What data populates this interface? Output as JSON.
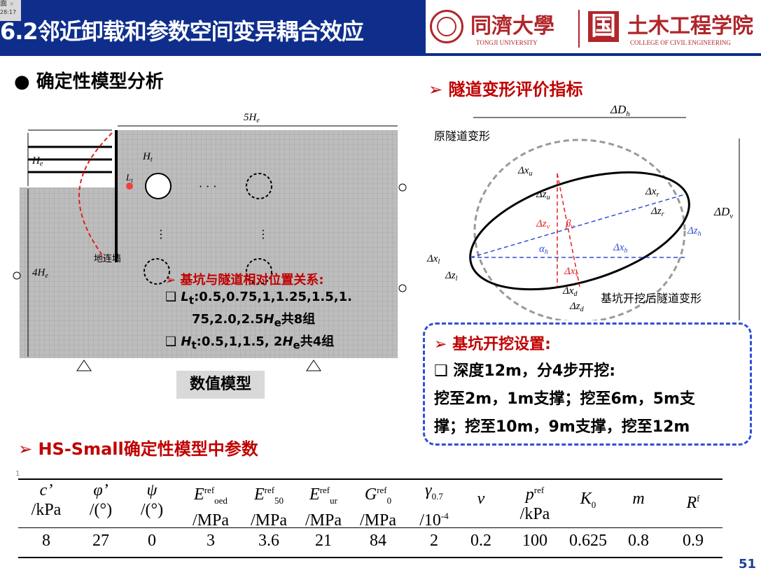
{
  "header": {
    "title": "6.2邻近卸载和参数空间变异耦合效应",
    "corner_tag_top": "面",
    "corner_tag_close": "×",
    "corner_tag_time": "28:17",
    "university_cn": "同濟大學",
    "university_en": "TONGJI UNIVERSITY",
    "college_cn": "土木工程学院",
    "college_en": "COLLEGE OF CIVIL ENGINEERING",
    "college_icon_glyph": "国",
    "accent_color": "#0f2e8c",
    "brand_red": "#b0262b"
  },
  "section_title": "确定性模型分析",
  "section_bullet": "●",
  "model": {
    "label_5He": "5H",
    "label_5He_sub": "e",
    "label_He": "H",
    "label_He_sub": "e",
    "label_Ht": "H",
    "label_Ht_sub": "t",
    "label_Lt": "L",
    "label_Lt_sub": "t",
    "label_4He": "4H",
    "label_4He_sub": "e",
    "label_wall": "地连墙",
    "dots_h": "· · ·",
    "caption": "数值模型"
  },
  "relation": {
    "heading": "基坑与隧道相对位置关系:",
    "lt_sym": "L",
    "lt_sub": "t",
    "lt_text_1": ":0.5,0.75,1,1.25,1.5,1.",
    "lt_text_2": "75,2.0,2.5",
    "lt_text_2_sym": "H",
    "lt_text_2_sub": "e",
    "lt_text_2_end": "共8组",
    "ht_sym": "H",
    "ht_sub": "t",
    "ht_text": ":0.5,1,1.5, 2",
    "ht_text_sym": "H",
    "ht_text_sub": "e",
    "ht_text_end": "共4组"
  },
  "tunnel": {
    "heading": "隧道变形评价指标",
    "label_original": "原隧道变形",
    "label_after": "基坑开挖后隧道变形",
    "dDh": "ΔD",
    "dDh_sub": "h",
    "dDv": "ΔD",
    "dDv_sub": "v",
    "dxu": "Δx",
    "dxu_sub": "u",
    "dzu": "Δz",
    "dzu_sub": "u",
    "dxr": "Δx",
    "dxr_sub": "r",
    "dzr": "Δz",
    "dzr_sub": "r",
    "dzv": "Δz",
    "dzv_sub": "v",
    "beta": "β",
    "beta_sub": "v",
    "dzh": "Δz",
    "dzh_sub": "h",
    "alpha": "α",
    "alpha_sub": "h",
    "dxh": "Δx",
    "dxh_sub": "h",
    "dxl": "Δx",
    "dxl_sub": "l",
    "dzl": "Δz",
    "dzl_sub": "l",
    "dxv": "Δx",
    "dxv_sub": "v",
    "dxd": "Δx",
    "dxd_sub": "d",
    "dzd": "Δz",
    "dzd_sub": "d"
  },
  "excavation": {
    "heading": "基坑开挖设置:",
    "line1": "深度12m，分4步开挖:",
    "line2": "挖至2m，1m支撑；挖至6m，5m支",
    "line3": "撑；挖至10m，9m支撑，挖至12m"
  },
  "params": {
    "heading": "HS-Small确定性模型中参数",
    "small_mark": "1",
    "headers": [
      {
        "sym": "c’",
        "unit": "/kPa"
      },
      {
        "sym": "φ’",
        "unit": "/(°)"
      },
      {
        "sym": "ψ",
        "unit": "/(°)"
      },
      {
        "sym": "E",
        "sup": "ref",
        "sub": "oed",
        "unit": "/MPa"
      },
      {
        "sym": "E",
        "sup": "ref",
        "sub": "50",
        "unit": "/MPa"
      },
      {
        "sym": "E",
        "sup": "ref",
        "sub": "ur",
        "unit": "/MPa"
      },
      {
        "sym": "G",
        "sup": "ref",
        "sub": "0",
        "unit": "/MPa"
      },
      {
        "sym": "γ",
        "sub": "0.7",
        "unit": "/10",
        "unit_sup": "-4"
      },
      {
        "sym": "v"
      },
      {
        "sym": "p",
        "sup": "ref",
        "unit": "/kPa"
      },
      {
        "sym": "K",
        "sub": "0"
      },
      {
        "sym": "m"
      },
      {
        "sym": "R",
        "sup": "f"
      }
    ],
    "values": [
      "8",
      "27",
      "0",
      "3",
      "3.6",
      "21",
      "84",
      "2",
      "0.2",
      "100",
      "0.625",
      "0.8",
      "0.9"
    ]
  },
  "page_number": "51",
  "colors": {
    "red": "#c00000",
    "blue_dash": "#2f4fd6",
    "page_num": "#1f3f9a"
  }
}
